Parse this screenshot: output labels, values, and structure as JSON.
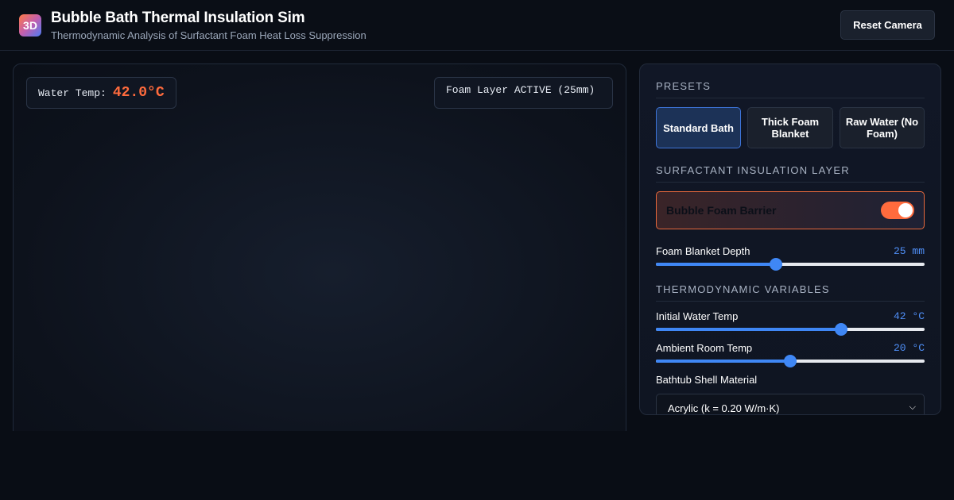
{
  "header": {
    "logo_text": "3D",
    "title": "Bubble Bath Thermal Insulation Sim",
    "subtitle": "Thermodynamic Analysis of Surfactant Foam Heat Loss Suppression",
    "reset_label": "Reset Camera"
  },
  "viewport": {
    "temp_label": "Water Temp:",
    "temp_value": "42.0°C",
    "foam_status": "Foam Layer ACTIVE (25mm)"
  },
  "panel": {
    "presets": {
      "title": "PRESETS",
      "items": [
        {
          "label": "Standard Bath",
          "active": true
        },
        {
          "label": "Thick Foam Blanket",
          "active": false
        },
        {
          "label": "Raw Water (No Foam)",
          "active": false
        }
      ]
    },
    "insulation": {
      "title": "SURFACTANT INSULATION LAYER",
      "toggle_label": "Bubble Foam Barrier",
      "toggle_on": true,
      "depth_label": "Foam Blanket Depth",
      "depth_value": "25 mm",
      "depth_fraction": 0.446
    },
    "thermo": {
      "title": "THERMODYNAMIC VARIABLES",
      "water_label": "Initial Water Temp",
      "water_value": "42 °C",
      "water_fraction": 0.69,
      "ambient_label": "Ambient Room Temp",
      "ambient_value": "20 °C",
      "ambient_fraction": 0.5,
      "material_label": "Bathtub Shell Material",
      "material_value": "Acrylic (k = 0.20 W/m·K)"
    }
  },
  "colors": {
    "accent_orange": "#ff6b3d",
    "accent_blue": "#3f87f5",
    "background": "#090d15"
  }
}
